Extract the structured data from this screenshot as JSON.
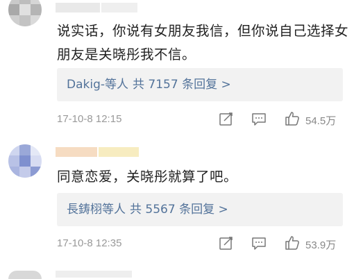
{
  "comments": [
    {
      "text": "说实话，你说有女朋友我信，但你说自己选择女朋友是关晓彤我不信。",
      "replies": {
        "users": "Dakig-等人",
        "count": "共 7157 条回复 >"
      },
      "time": "17-10-8 12:15",
      "likes": "54.5万",
      "avatar_colors": [
        "#c9c9c9",
        "#bdbdbd",
        "#d6d6d6",
        "#a9a9a9",
        "#e0e0e0",
        "#b5b5b5",
        "#cfcfcf",
        "#c3c3c3",
        "#dadada"
      ],
      "icons": [
        "share-icon",
        "comment-icon",
        "thumbs-up-icon"
      ]
    },
    {
      "text": "同意恋爱，关晓彤就算了吧。",
      "replies": {
        "users": "長鋳栩等人",
        "count": "共 5567 条回复 >"
      },
      "time": "17-10-8 12:35",
      "likes": "53.9万",
      "avatar_colors": [
        "#cfd6ef",
        "#9aa8d8",
        "#e4e8f6",
        "#b9c2e6",
        "#7f90cf",
        "#d7dcf2",
        "#aab5e0",
        "#c4cbea",
        "#8c9bd3"
      ],
      "icons": [
        "share-icon",
        "comment-icon",
        "thumbs-up-icon"
      ]
    }
  ],
  "colors": {
    "link": "#53739a",
    "reply_bg": "#f2f2f2",
    "meta": "#999999",
    "name_blur_1": "#e6e6e6",
    "name_blur_2_a": "#f6dcc2",
    "name_blur_2_b": "#f7ecc0"
  }
}
